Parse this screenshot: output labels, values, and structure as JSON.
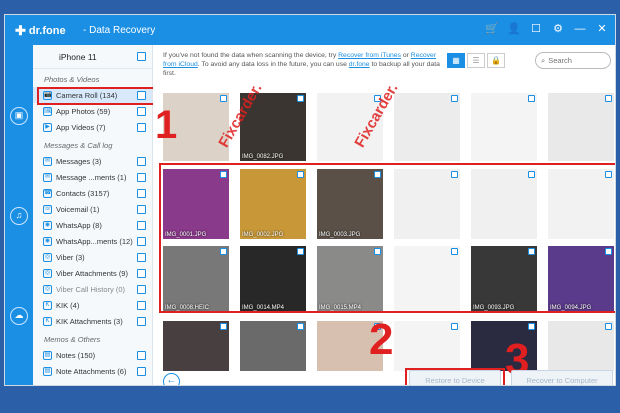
{
  "window": {
    "brand": "dr.fone",
    "title": "- Data Recovery"
  },
  "sidebar": {
    "device": "iPhone 11",
    "sections": [
      {
        "title": "Photos & Videos",
        "items": [
          {
            "label": "Camera Roll (134)",
            "selected": true
          },
          {
            "label": "App Photos (59)"
          },
          {
            "label": "App Videos (7)"
          }
        ]
      },
      {
        "title": "Messages & Call log",
        "items": [
          {
            "label": "Messages (3)"
          },
          {
            "label": "Message ...ments (1)"
          },
          {
            "label": "Contacts (3157)"
          },
          {
            "label": "Voicemail (1)"
          },
          {
            "label": "WhatsApp (8)"
          },
          {
            "label": "WhatsApp...ments (12)"
          },
          {
            "label": "Viber (3)"
          },
          {
            "label": "Viber Attachments (9)"
          },
          {
            "label": "Viber Call History (0)",
            "dim": true
          },
          {
            "label": "KIK (4)"
          },
          {
            "label": "KIK Attachments (3)"
          }
        ]
      },
      {
        "title": "Memos & Others",
        "items": [
          {
            "label": "Notes (150)"
          },
          {
            "label": "Note Attachments (6)"
          }
        ]
      }
    ]
  },
  "notice": {
    "pre": "If you've not found the data when scanning the device, try",
    "link1": "Recover from iTunes",
    "or": "or",
    "link2": "Recover from iCloud",
    "mid": ". To avoid any data loss in the future, you can use",
    "link3": "dr.fone",
    "post": "to backup all your data first."
  },
  "search": {
    "placeholder": "Search"
  },
  "thumbnails": [
    {
      "caption": "",
      "color": "#ddd2c8"
    },
    {
      "caption": "IMG_0082.JPG",
      "color": "#3a3530"
    },
    {
      "caption": "",
      "color": "#f2f2f2"
    },
    {
      "caption": "",
      "color": "#ececec"
    },
    {
      "caption": "",
      "color": "#f4f4f4"
    },
    {
      "caption": "",
      "color": "#e9e9e9"
    },
    {
      "caption": "IMG_0086.JPG",
      "color": "#6a5050"
    },
    {
      "caption": "IMG_0001.JPG",
      "color": "#8a3a8a"
    },
    {
      "caption": "IMG_0002.JPG",
      "color": "#c89838"
    },
    {
      "caption": "IMG_0003.JPG",
      "color": "#5a5048"
    },
    {
      "caption": "",
      "color": "#f0f0f0"
    },
    {
      "caption": "",
      "color": "#f0f0f0"
    },
    {
      "caption": "",
      "color": "#f2f2f2"
    },
    {
      "caption": "IMG_0003.HEIC",
      "color": "#6a6860"
    },
    {
      "caption": "IMG_0008.HEIC",
      "color": "#787878"
    },
    {
      "caption": "IMG_0014.MP4",
      "color": "#282828"
    },
    {
      "caption": "IMG_0015.MP4",
      "color": "#8a8a88"
    },
    {
      "caption": "",
      "color": "#f4f4f4"
    },
    {
      "caption": "IMG_0093.JPG",
      "color": "#383838"
    },
    {
      "caption": "IMG_0094.JPG",
      "color": "#5a3a8a"
    },
    {
      "caption": "",
      "color": "#2a2a3a"
    },
    {
      "caption": "",
      "color": "#484040"
    },
    {
      "caption": "",
      "color": "#6a6a6a"
    },
    {
      "caption": "",
      "color": "#d8c0b0"
    },
    {
      "caption": "",
      "color": "#f4f4f4"
    },
    {
      "caption": "",
      "color": "#2a2a40"
    },
    {
      "caption": "",
      "color": "#e8e8e8"
    }
  ],
  "actions": {
    "restore_device": "Restore to Device",
    "recover_computer": "Recover to Computer"
  },
  "annotations": {
    "one": "1",
    "two": "2",
    "three": "3"
  },
  "watermark": "Fixcarder."
}
